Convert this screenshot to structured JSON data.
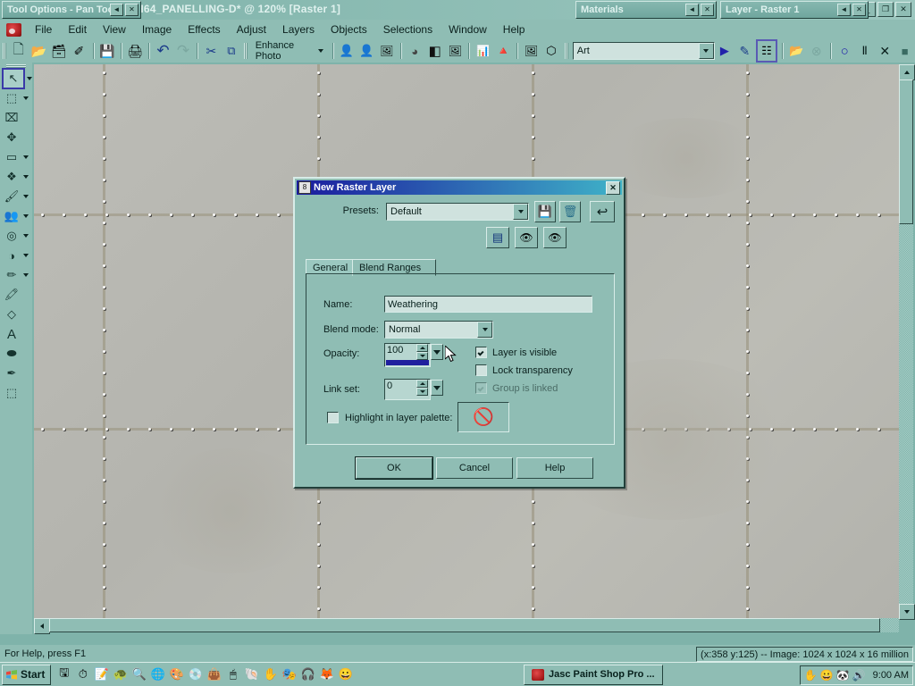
{
  "window": {
    "document_title": "H64_PANELLING-D* @ 120% [Raster 1]",
    "minimize": "_",
    "restore": "❐",
    "close": "✕",
    "mdi_minimize": "_",
    "mdi_restore": "❐",
    "mdi_close": "✕"
  },
  "palettes": [
    {
      "title": "Tool Options - Pan Tool",
      "roll": "◄",
      "close": "✕"
    },
    {
      "title": "Materials",
      "roll": "◄",
      "close": "✕"
    },
    {
      "title": "Layer - Raster 1",
      "roll": "◄",
      "close": "✕"
    }
  ],
  "menu": {
    "app_icon": "paintshop-logo",
    "items": [
      "File",
      "Edit",
      "View",
      "Image",
      "Effects",
      "Adjust",
      "Layers",
      "Objects",
      "Selections",
      "Window",
      "Help"
    ]
  },
  "toolbar": {
    "left_buttons": [
      {
        "name": "new-file",
        "glyph": "🗋"
      },
      {
        "name": "open-file",
        "glyph": "📂"
      },
      {
        "name": "browse",
        "glyph": "🗃"
      },
      {
        "name": "twain-acquire",
        "glyph": "✐"
      },
      {
        "name": "save",
        "glyph": "💾"
      },
      {
        "name": "print",
        "glyph": "🖨"
      },
      {
        "name": "undo",
        "glyph": "↶"
      },
      {
        "name": "redo",
        "glyph": "↷"
      },
      {
        "name": "cut",
        "glyph": "✂"
      },
      {
        "name": "copy",
        "glyph": "⧉"
      }
    ],
    "enhance_photo_label": "Enhance Photo",
    "photo_buttons": [
      {
        "name": "one-step-photo-fix",
        "glyph": "👤"
      },
      {
        "name": "one-step-noise-removal",
        "glyph": "👤"
      },
      {
        "name": "smart-photo-fix",
        "glyph": "🖼"
      },
      {
        "name": "red-eye-removal",
        "glyph": "◕"
      },
      {
        "name": "brightness-contrast",
        "glyph": "◧"
      },
      {
        "name": "fill-flash",
        "glyph": "🖼"
      },
      {
        "name": "histogram-adjust",
        "glyph": "📊"
      },
      {
        "name": "color-balance",
        "glyph": "🔺"
      },
      {
        "name": "makeover-tool",
        "glyph": "🖼"
      },
      {
        "name": "picture-frame",
        "glyph": "⬡"
      }
    ],
    "script_select_value": "Art",
    "script_buttons": [
      {
        "name": "run-script",
        "glyph": "▶"
      },
      {
        "name": "edit-script",
        "glyph": "✎"
      },
      {
        "name": "toggle-execution-mode",
        "glyph": "☷"
      },
      {
        "name": "open-script",
        "glyph": "📂"
      },
      {
        "name": "stop-script",
        "glyph": "⊗"
      },
      {
        "name": "record-script",
        "glyph": "○"
      },
      {
        "name": "pause-script",
        "glyph": "Ⅱ"
      },
      {
        "name": "cancel-script",
        "glyph": "✕"
      },
      {
        "name": "save-recording",
        "glyph": "■"
      }
    ]
  },
  "tools": [
    {
      "name": "pan-tool",
      "glyph": "↖",
      "selected": true,
      "has_dropdown": true
    },
    {
      "name": "zoom-tool",
      "glyph": "⬚",
      "selected": false,
      "has_dropdown": true
    },
    {
      "name": "crop-tool",
      "glyph": "⌧",
      "selected": false,
      "has_dropdown": false
    },
    {
      "name": "move-tool",
      "glyph": "✥",
      "selected": false,
      "has_dropdown": false
    },
    {
      "name": "selection-tool",
      "glyph": "▭",
      "selected": false,
      "has_dropdown": true
    },
    {
      "name": "magic-wand-tool",
      "glyph": "❖",
      "selected": false,
      "has_dropdown": true
    },
    {
      "name": "paint-brush-tool",
      "glyph": "🖌",
      "selected": false,
      "has_dropdown": true
    },
    {
      "name": "clone-brush-tool",
      "glyph": "👥",
      "selected": false,
      "has_dropdown": true
    },
    {
      "name": "retouch-tool",
      "glyph": "◎",
      "selected": false,
      "has_dropdown": true
    },
    {
      "name": "gradient-tool",
      "glyph": "◑",
      "selected": false,
      "has_dropdown": true
    },
    {
      "name": "eraser-tool",
      "glyph": "✏",
      "selected": false,
      "has_dropdown": true
    },
    {
      "name": "picture-tube-tool",
      "glyph": "🖍",
      "selected": false,
      "has_dropdown": false
    },
    {
      "name": "warp-brush-tool",
      "glyph": "◇",
      "selected": false,
      "has_dropdown": false
    },
    {
      "name": "text-tool",
      "glyph": "A",
      "selected": false,
      "has_dropdown": false
    },
    {
      "name": "preset-shape-tool",
      "glyph": "⬬",
      "selected": false,
      "has_dropdown": false
    },
    {
      "name": "pen-tool",
      "glyph": "✒",
      "selected": false,
      "has_dropdown": false
    },
    {
      "name": "deform-tool",
      "glyph": "⬚",
      "selected": false,
      "has_dropdown": false
    }
  ],
  "dialog": {
    "icon": "layer-icon",
    "title": "New Raster Layer",
    "close_label": "✕",
    "presets_label": "Presets:",
    "presets_value": "Default",
    "preset_buttons": [
      {
        "name": "save-preset-button",
        "glyph": "💾"
      },
      {
        "name": "delete-preset-button",
        "glyph": "🗑"
      },
      {
        "name": "reset-to-default-button",
        "glyph": "↩"
      },
      {
        "name": "toggle-options-panel-button",
        "glyph": "▤"
      },
      {
        "name": "auto-proof-button",
        "glyph": "👁"
      },
      {
        "name": "preview-button",
        "glyph": "👁"
      }
    ],
    "tabs": [
      {
        "label": "General",
        "active": true
      },
      {
        "label": "Blend Ranges",
        "active": false
      }
    ],
    "name_label": "Name:",
    "name_value": "Weathering",
    "blend_mode_label": "Blend mode:",
    "blend_mode_value": "Normal",
    "opacity_label": "Opacity:",
    "opacity_value": "100",
    "opacity_percent": 100,
    "link_set_label": "Link set:",
    "link_set_value": "0",
    "checkboxes": [
      {
        "label": "Layer is visible",
        "checked": true,
        "disabled": false
      },
      {
        "label": "Lock transparency",
        "checked": false,
        "disabled": false
      },
      {
        "label": "Group is linked",
        "checked": true,
        "disabled": true
      }
    ],
    "highlight_label": "Highlight in layer palette:",
    "highlight_checked": false,
    "highlight_swatch": "🚫",
    "buttons": [
      {
        "label": "OK",
        "default": true
      },
      {
        "label": "Cancel",
        "default": false
      },
      {
        "label": "Help",
        "default": false
      }
    ]
  },
  "status": {
    "hint": "For Help, press F1",
    "info": "(x:358 y:125) -- Image:  1024 x 1024 x 16 million"
  },
  "taskbar": {
    "start_label": "Start",
    "quick_launch": [
      {
        "name": "quicklaunch-memory",
        "glyph": "🖫"
      },
      {
        "name": "quicklaunch-clock-red",
        "glyph": "⏱"
      },
      {
        "name": "quicklaunch-notepad",
        "glyph": "📝"
      },
      {
        "name": "quicklaunch-shield",
        "glyph": "🐢"
      },
      {
        "name": "quicklaunch-search",
        "glyph": "🔍"
      },
      {
        "name": "quicklaunch-internet-explorer",
        "glyph": "🌐"
      },
      {
        "name": "quicklaunch-paint-shop",
        "glyph": "🎨"
      },
      {
        "name": "quicklaunch-disc",
        "glyph": "💿"
      },
      {
        "name": "quicklaunch-bag",
        "glyph": "👜"
      },
      {
        "name": "quicklaunch-mouse",
        "glyph": "🖱"
      },
      {
        "name": "quicklaunch-shell",
        "glyph": "🐚"
      },
      {
        "name": "quicklaunch-hand",
        "glyph": "✋"
      },
      {
        "name": "quicklaunch-mask",
        "glyph": "🎭"
      },
      {
        "name": "quicklaunch-headphones",
        "glyph": "🎧"
      },
      {
        "name": "quicklaunch-firefox",
        "glyph": "🦊"
      },
      {
        "name": "quicklaunch-smiley",
        "glyph": "😀"
      }
    ],
    "task_label": "Jasc Paint Shop Pro ...",
    "task_icon": "paintshop-logo",
    "tray": [
      {
        "name": "tray-hand-icon",
        "glyph": "✋"
      },
      {
        "name": "tray-smiley-icon",
        "glyph": "😀"
      },
      {
        "name": "tray-panda-icon",
        "glyph": "🐼"
      },
      {
        "name": "tray-volume-icon",
        "glyph": "🔊"
      }
    ],
    "clock": "9:00 AM"
  },
  "colors": {
    "desktop": "#7fb3aa",
    "face": "#8fbdb4",
    "canvas": "#b7b7b2",
    "dialog_title_start": "#1b1b9e",
    "dialog_title_end": "#3fb3c8",
    "opacity_bar": "#1f1f9e",
    "selection_outline": "#3a3aa8"
  }
}
